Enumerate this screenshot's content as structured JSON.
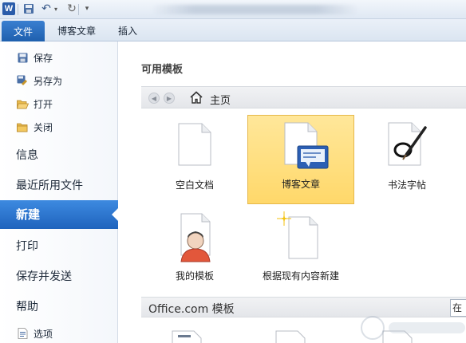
{
  "colors": {
    "accent": "#1f63bd",
    "selected_tile": "#ffd86a",
    "nav_text": "#1e2a3a"
  },
  "ribbon": {
    "file_tab": "文件",
    "tabs": [
      "博客文章",
      "插入"
    ]
  },
  "nav": {
    "save": "保存",
    "save_as": "另存为",
    "open": "打开",
    "close": "关闭",
    "info": "信息",
    "recent": "最近所用文件",
    "new": "新建",
    "print": "打印",
    "save_send": "保存并发送",
    "help": "帮助",
    "options": "选项"
  },
  "main": {
    "section_title": "可用模板",
    "breadcrumb_home": "主页",
    "templates": [
      {
        "label": "空白文档",
        "icon": "blank-doc-icon",
        "selected": false
      },
      {
        "label": "博客文章",
        "icon": "blog-post-icon",
        "selected": true
      },
      {
        "label": "书法字帖",
        "icon": "calligraphy-icon",
        "selected": false
      },
      {
        "label": "我的模板",
        "icon": "my-templates-icon",
        "selected": false
      },
      {
        "label": "根据现有内容新建",
        "icon": "new-from-existing-icon",
        "selected": false
      }
    ],
    "office_title": "Office.com 模板",
    "search_value": "在"
  }
}
